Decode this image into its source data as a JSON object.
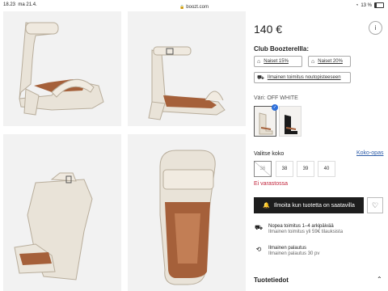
{
  "status_bar": {
    "time": "18.23",
    "date": "ma 21.4.",
    "url": "boozt.com",
    "battery": "13 %"
  },
  "product": {
    "price": "140 €",
    "club_title": "Club Boozterellla:",
    "club_offers": [
      "Naiset 15%",
      "Naiset 20%"
    ],
    "delivery_offer": "Ilmainen toimitus noutopisteeseen",
    "color_label": "Väri: OFF WHITE",
    "colors": [
      {
        "name": "off-white",
        "selected": true
      },
      {
        "name": "black",
        "selected": false
      }
    ],
    "size_label": "Valitse koko",
    "size_guide": "Koko-opas",
    "sizes": [
      {
        "label": "36",
        "available": false
      },
      {
        "label": "38",
        "available": true
      },
      {
        "label": "39",
        "available": true
      },
      {
        "label": "40",
        "available": true
      }
    ],
    "stock_status": "Ei varastossa",
    "notify_button": "Ilmoita kun tuotetta on saatavilla",
    "shipping": [
      {
        "title": "Nopea toimitus 1–4 arkipäivää",
        "sub": "Ilmainen toimitus yli 59€ tilauksista",
        "icon": "truck-icon"
      },
      {
        "title": "Ilmainen palautus",
        "sub": "Ilmainen palautus 30 pv",
        "icon": "return-icon"
      }
    ],
    "details_label": "Tuotetiedot"
  },
  "colors": {
    "accent_blue": "#2d6fda",
    "stock_red": "#c1253c",
    "button_dark": "#1d1d1d"
  }
}
